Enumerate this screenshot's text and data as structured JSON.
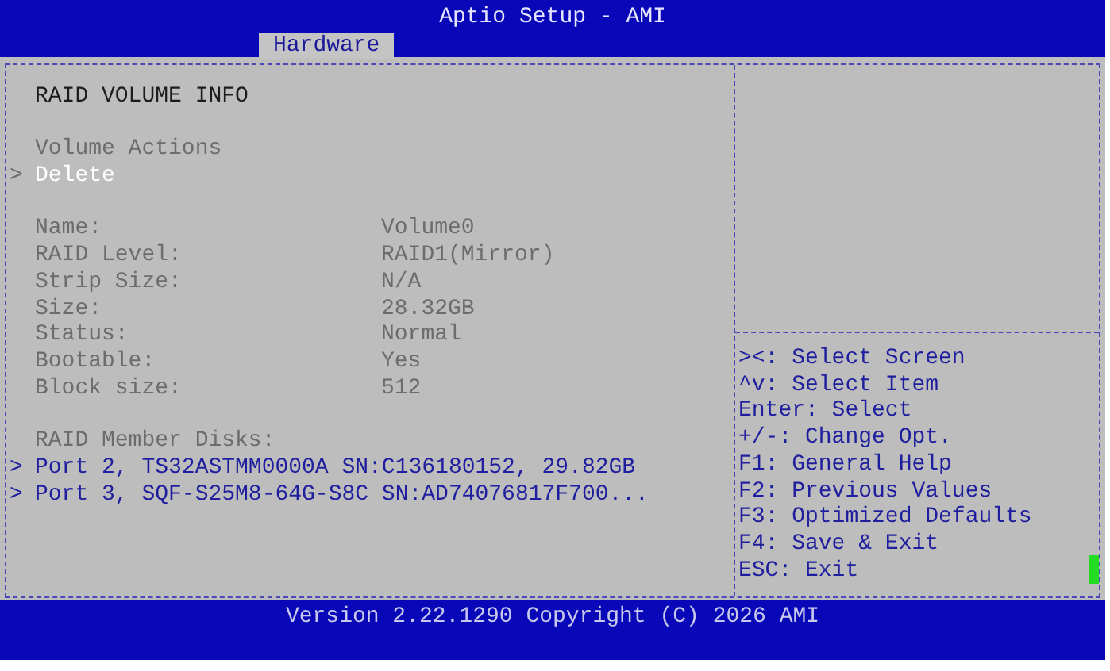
{
  "window": {
    "title": "Aptio Setup - AMI"
  },
  "tabs": [
    {
      "label": "Hardware",
      "selected": true
    }
  ],
  "main_panel": {
    "sections": [
      {
        "rows": [
          {
            "kind": "heading",
            "text": "RAID VOLUME INFO"
          }
        ]
      },
      {
        "rows": [
          {
            "kind": "label",
            "text": "Volume Actions"
          },
          {
            "kind": "action",
            "marker": ">",
            "text": "Delete",
            "selected": true
          }
        ]
      },
      {
        "rows": [
          {
            "kind": "field",
            "label": "Name:",
            "value": "Volume0"
          },
          {
            "kind": "field",
            "label": "RAID Level:",
            "value": "RAID1(Mirror)"
          },
          {
            "kind": "field",
            "label": "Strip Size:",
            "value": "N/A"
          },
          {
            "kind": "field",
            "label": "Size:",
            "value": "28.32GB"
          },
          {
            "kind": "field",
            "label": "Status:",
            "value": "Normal"
          },
          {
            "kind": "field",
            "label": "Bootable:",
            "value": "Yes"
          },
          {
            "kind": "field",
            "label": "Block size:",
            "value": "512"
          }
        ]
      },
      {
        "rows": [
          {
            "kind": "label",
            "text": "RAID Member Disks:"
          },
          {
            "kind": "link",
            "marker": ">",
            "text": "Port 2, TS32ASTMM0000A SN:C136180152, 29.82GB",
            "selected": false
          },
          {
            "kind": "link",
            "marker": ">",
            "text": "Port 3, SQF-S25M8-64G-S8C SN:AD74076817F700...",
            "selected": false
          }
        ]
      }
    ]
  },
  "help_keys": [
    "><: Select Screen",
    "^v: Select Item",
    "Enter: Select",
    "+/-: Change Opt.",
    "F1: General Help",
    "F2: Previous Values",
    "F3: Optimized Defaults",
    "F4: Save & Exit",
    "ESC: Exit"
  ],
  "status_bar": {
    "text": "Version 2.22.1290 Copyright (C) 2026 AMI"
  }
}
